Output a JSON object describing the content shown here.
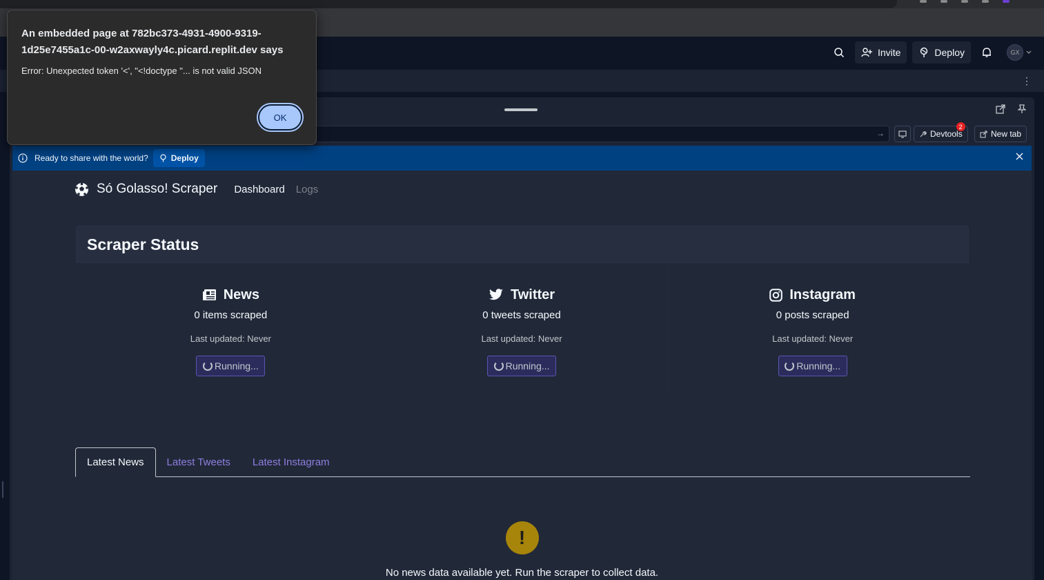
{
  "replit_header": {
    "invite_label": "Invite",
    "deploy_label": "Deploy",
    "avatar_initials": "GX"
  },
  "webview": {
    "devtools_label": "Devtools",
    "devtools_badge": "2",
    "new_tab_label": "New tab"
  },
  "banner": {
    "text": "Ready to share with the world?",
    "deploy_label": "Deploy"
  },
  "app": {
    "brand": "Só Golasso! Scraper",
    "nav": [
      "Dashboard",
      "Logs"
    ],
    "status_title": "Scraper Status",
    "sources": [
      {
        "icon": "newspaper-icon",
        "name": "News",
        "count": "0 items scraped",
        "last_updated": "Last updated: Never",
        "button": "Running..."
      },
      {
        "icon": "twitter-icon",
        "name": "Twitter",
        "count": "0 tweets scraped",
        "last_updated": "Last updated: Never",
        "button": "Running..."
      },
      {
        "icon": "instagram-icon",
        "name": "Instagram",
        "count": "0 posts scraped",
        "last_updated": "Last updated: Never",
        "button": "Running..."
      }
    ],
    "tabs": [
      "Latest News",
      "Latest Tweets",
      "Latest Instagram"
    ],
    "empty_message": "No news data available yet. Run the scraper to collect data."
  },
  "dialog": {
    "title": "An embedded page at 782bc373-4931-4900-9319-1d25e7455a1c-00-w2axwayly4c.picard.replit.dev says",
    "message": "Error: Unexpected token '<', \"<!doctype \"... is not valid JSON",
    "ok_label": "OK"
  },
  "colors": {
    "accent_purple": "#8f7ee0",
    "banner_blue": "#004182",
    "warning": "#a7840a"
  }
}
